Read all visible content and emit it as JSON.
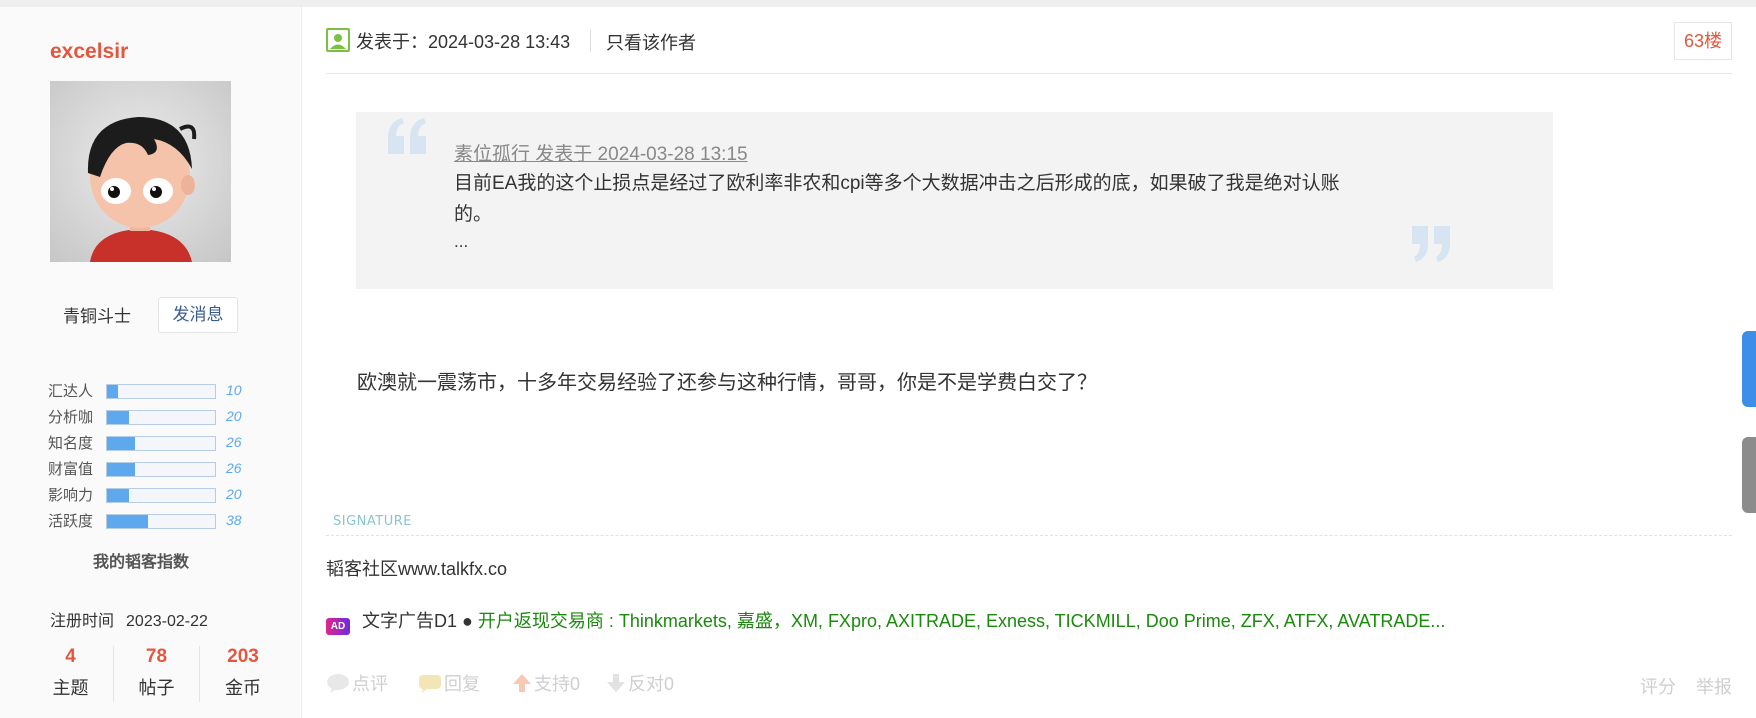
{
  "user": {
    "name": "excelsir",
    "rank": "青铜斗士",
    "message_button": "发消息",
    "stats": [
      {
        "label": "汇达人",
        "value": "10",
        "fraction": 0.1
      },
      {
        "label": "分析咖",
        "value": "20",
        "fraction": 0.2
      },
      {
        "label": "知名度",
        "value": "26",
        "fraction": 0.26
      },
      {
        "label": "财富值",
        "value": "26",
        "fraction": 0.26
      },
      {
        "label": "影响力",
        "value": "20",
        "fraction": 0.2
      },
      {
        "label": "活跃度",
        "value": "38",
        "fraction": 0.38
      }
    ],
    "index_title": "我的韬客指数",
    "register_label": "注册时间",
    "register_date": "2023-02-22",
    "counts": [
      {
        "num": "4",
        "label": "主题"
      },
      {
        "num": "78",
        "label": "帖子"
      },
      {
        "num": "203",
        "label": "金币"
      }
    ]
  },
  "post": {
    "posted_at": "发表于：2024-03-28 13:43",
    "only_author": "只看该作者",
    "floor": "63楼",
    "quote": {
      "ref": "素位孤行 发表于 2024-03-28 13:15",
      "text": "目前EA我的这个止损点是经过了欧利率非农和cpi等多个大数据冲击之后形成的底，如果破了我是绝对认账的。",
      "more": "..."
    },
    "content": "欧澳就一震荡市，十多年交易经验了还参与这种行情，哥哥，你是不是学费白交了？",
    "signature_label": "SIGNATURE",
    "signature": "韬客社区www.talkfx.co",
    "ad": {
      "badge": "AD",
      "label": "文字广告D1 ●",
      "link": "开户返现交易商 : Thinkmarkets, 嘉盛，XM, FXpro, AXITRADE, Exness, TICKMILL, Doo Prime, ZFX, ATFX, AVATRADE..."
    },
    "actions": {
      "comment": "点评",
      "reply": "回复",
      "support": "支持0",
      "oppose": "反对0",
      "rate": "评分",
      "report": "举报"
    }
  },
  "colors": {
    "accent_red": "#e3573e",
    "link_green": "#1a8a0c",
    "bar_blue": "#5ea9ee"
  }
}
